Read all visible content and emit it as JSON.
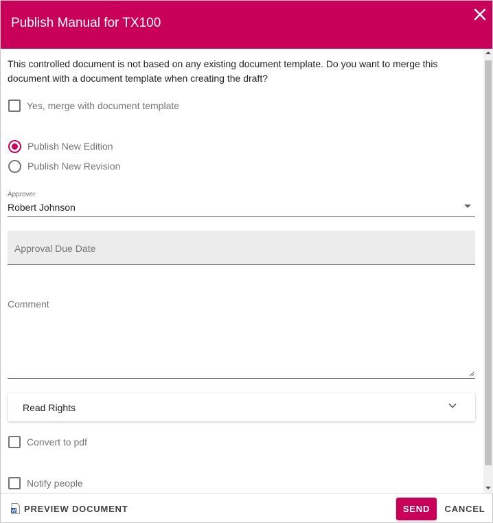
{
  "dialog": {
    "title": "Publish Manual for TX100",
    "close_icon": "close-icon",
    "accent_color": "#c8005a"
  },
  "intro_text": "This controlled document is not based on any existing document template. Do you want to merge this document with a document template when creating the draft?",
  "merge_option": {
    "label": "Yes, merge with document template",
    "checked": false
  },
  "publish_options": [
    {
      "label": "Publish New Edition",
      "selected": true
    },
    {
      "label": "Publish New Revision",
      "selected": false
    }
  ],
  "approver": {
    "label": "Approver",
    "value": "Robert Johnson",
    "icon": "dropdown-arrow-icon"
  },
  "approval_due_date": {
    "placeholder": "Approval Due Date",
    "value": ""
  },
  "comment": {
    "placeholder": "Comment",
    "value": ""
  },
  "read_rights": {
    "label": "Read Rights",
    "icon": "chevron-down-icon",
    "expanded": false
  },
  "convert_to_pdf": {
    "label": "Convert to pdf",
    "checked": false
  },
  "notify_people": {
    "label": "Notify people",
    "checked": false
  },
  "footer": {
    "preview_label": "PREVIEW DOCUMENT",
    "preview_icon": "word-document-icon",
    "send_label": "SEND",
    "cancel_label": "CANCEL"
  }
}
